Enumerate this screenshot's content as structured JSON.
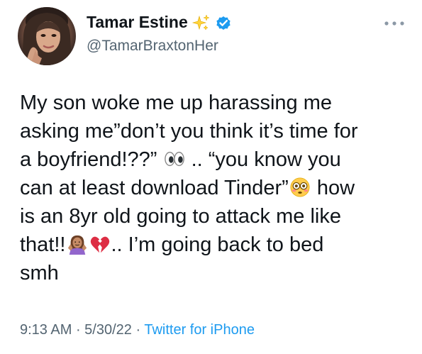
{
  "author": {
    "display_name": "Tamar Estine",
    "handle": "@TamarBraxtonHer",
    "verified": true,
    "name_icon": "sparkles-icon",
    "verified_icon": "verified-badge-icon"
  },
  "tweet": {
    "lines": [
      [
        "My son woke me up harassing me"
      ],
      [
        "asking me”don’t you think it’s time for"
      ],
      [
        "a boyfriend!??” ",
        " .. “you know you"
      ],
      [
        "can at least download Tinder”",
        " how"
      ],
      [
        "is an 8yr old going to attack me like"
      ],
      [
        "that!!",
        "",
        ".. I’m going back to bed"
      ],
      [
        "smh"
      ]
    ],
    "emojis": [
      "eyes-icon",
      "flushed-face-icon",
      "woman-shrugging-icon",
      "broken-heart-icon"
    ]
  },
  "meta": {
    "time": "9:13 AM",
    "separator": " · ",
    "date": "5/30/22",
    "source": "Twitter for iPhone"
  },
  "colors": {
    "text": "#0f1419",
    "secondary": "#536471",
    "link": "#1d9bf0",
    "verified": "#1d9bf0"
  }
}
